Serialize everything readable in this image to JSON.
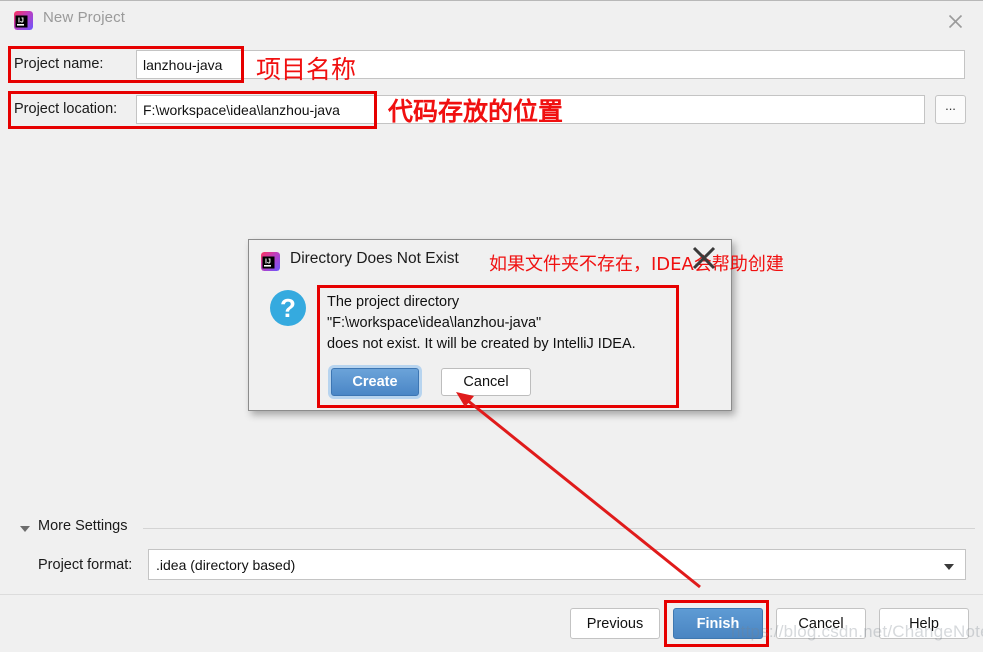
{
  "window": {
    "title": "New Project",
    "logo_icon": "intellij-idea-icon",
    "close_icon": "close-icon"
  },
  "form": {
    "name_label": "Project name:",
    "name_value": "lanzhou-java",
    "location_label": "Project location:",
    "location_value": "F:\\workspace\\idea\\lanzhou-java",
    "browse_label": "...",
    "browse_icon": "ellipsis-icon"
  },
  "annotations": {
    "name_note": "项目名称",
    "location_note": "代码存放的位置",
    "dialog_note": "如果文件夹不存在，IDEA会帮助创建",
    "highlight_color": "#e60000",
    "note_color": "#f01010",
    "arrow_color": "#e01b1b"
  },
  "dialog": {
    "logo_icon": "intellij-idea-icon",
    "title": "Directory Does Not Exist",
    "icon": "question-icon",
    "message_lines": [
      "The project directory",
      "\"F:\\workspace\\idea\\lanzhou-java\"",
      "does not exist. It will be created by IntelliJ IDEA."
    ],
    "create_label": "Create",
    "cancel_label": "Cancel",
    "primary_color": "#4a86c6"
  },
  "more_settings": {
    "label": "More Settings",
    "caret_icon": "chevron-down-icon"
  },
  "project_format": {
    "label": "Project format:",
    "value": ".idea (directory based)",
    "caret_icon": "chevron-down-icon"
  },
  "footer": {
    "previous_label": "Previous",
    "finish_label": "Finish",
    "cancel_label": "Cancel",
    "help_label": "Help",
    "primary_color": "#4a85c2"
  },
  "watermark": {
    "text": "https://blog.csdn.net/ChangeNote"
  }
}
